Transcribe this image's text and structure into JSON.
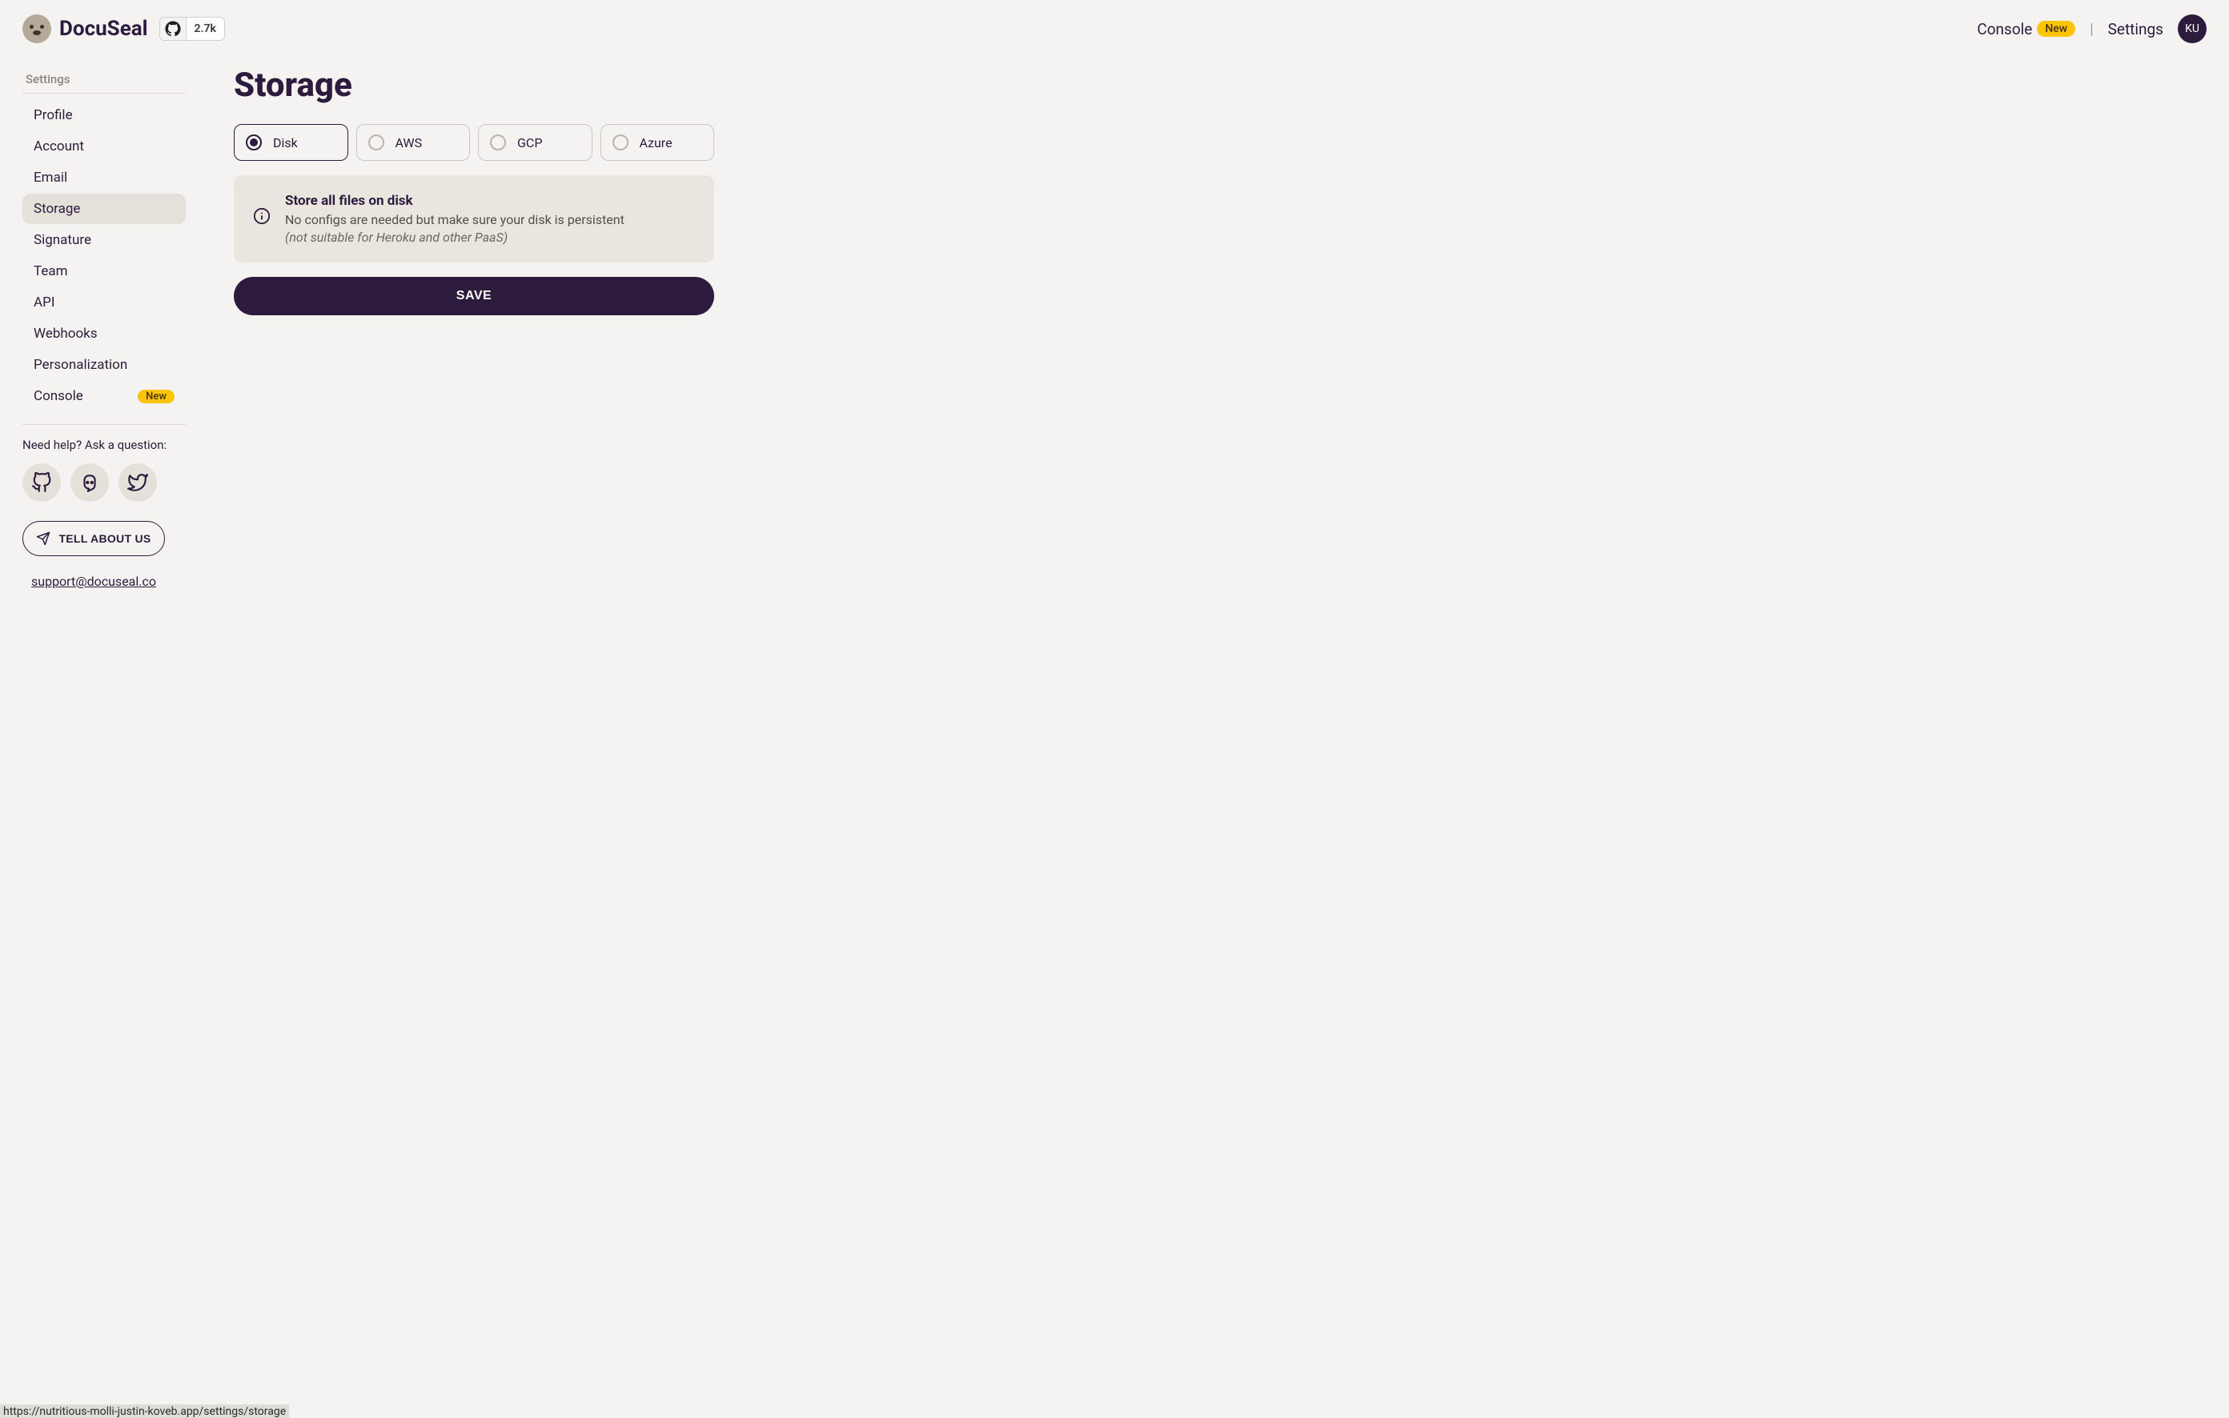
{
  "header": {
    "brand": "DocuSeal",
    "github_stars": "2.7k",
    "nav": {
      "console": "Console",
      "console_badge": "New",
      "settings": "Settings"
    },
    "avatar_initials": "KU"
  },
  "sidebar": {
    "heading": "Settings",
    "items": [
      {
        "label": "Profile",
        "active": false
      },
      {
        "label": "Account",
        "active": false
      },
      {
        "label": "Email",
        "active": false
      },
      {
        "label": "Storage",
        "active": true
      },
      {
        "label": "Signature",
        "active": false
      },
      {
        "label": "Team",
        "active": false
      },
      {
        "label": "API",
        "active": false
      },
      {
        "label": "Webhooks",
        "active": false
      },
      {
        "label": "Personalization",
        "active": false
      },
      {
        "label": "Console",
        "active": false,
        "badge": "New"
      }
    ],
    "help_text": "Need help? Ask a question:",
    "tell_button": "TELL ABOUT US",
    "support_email": "support@docuseal.co"
  },
  "main": {
    "title": "Storage",
    "options": [
      {
        "label": "Disk",
        "selected": true
      },
      {
        "label": "AWS",
        "selected": false
      },
      {
        "label": "GCP",
        "selected": false
      },
      {
        "label": "Azure",
        "selected": false
      }
    ],
    "info": {
      "title": "Store all files on disk",
      "desc": "No configs are needed but make sure your disk is persistent",
      "note": "(not suitable for Heroku and other PaaS)"
    },
    "save_label": "SAVE"
  },
  "status_bar": "https://nutritious-molli-justin-koveb.app/settings/storage"
}
